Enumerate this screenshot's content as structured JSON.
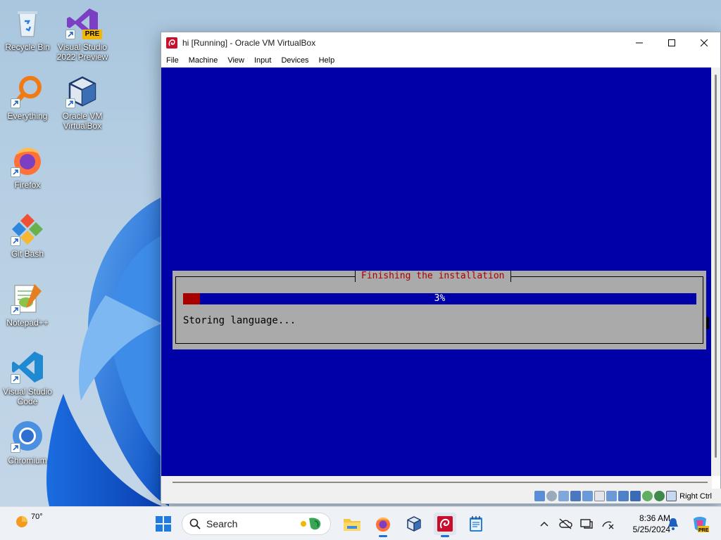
{
  "desktop": {
    "icons": [
      {
        "label": "Recycle Bin"
      },
      {
        "label": "Visual Studio 2022 Preview",
        "badge": "PRE"
      },
      {
        "label": "Everything"
      },
      {
        "label": "Oracle VM VirtualBox"
      },
      {
        "label": "Firefox"
      },
      {
        "label": "Git Bash"
      },
      {
        "label": "Notepad++"
      },
      {
        "label": "Visual Studio Code"
      },
      {
        "label": "Chromium"
      }
    ]
  },
  "window": {
    "title": "hi [Running] - Oracle VM VirtualBox",
    "menu": [
      "File",
      "Machine",
      "View",
      "Input",
      "Devices",
      "Help"
    ],
    "host_key": "Right Ctrl"
  },
  "installer": {
    "dialog_title": "Finishing the installation",
    "progress_percent": 3,
    "progress_label": "3%",
    "status_text": "Storing language...",
    "colors": {
      "background": "#0000a8",
      "dialog": "#aaaaaa",
      "title": "#a80000",
      "progress_fill": "#a80000"
    }
  },
  "taskbar": {
    "weather_temp": "70°",
    "search_label": "Search",
    "time": "8:36 AM",
    "date": "5/25/2024"
  }
}
